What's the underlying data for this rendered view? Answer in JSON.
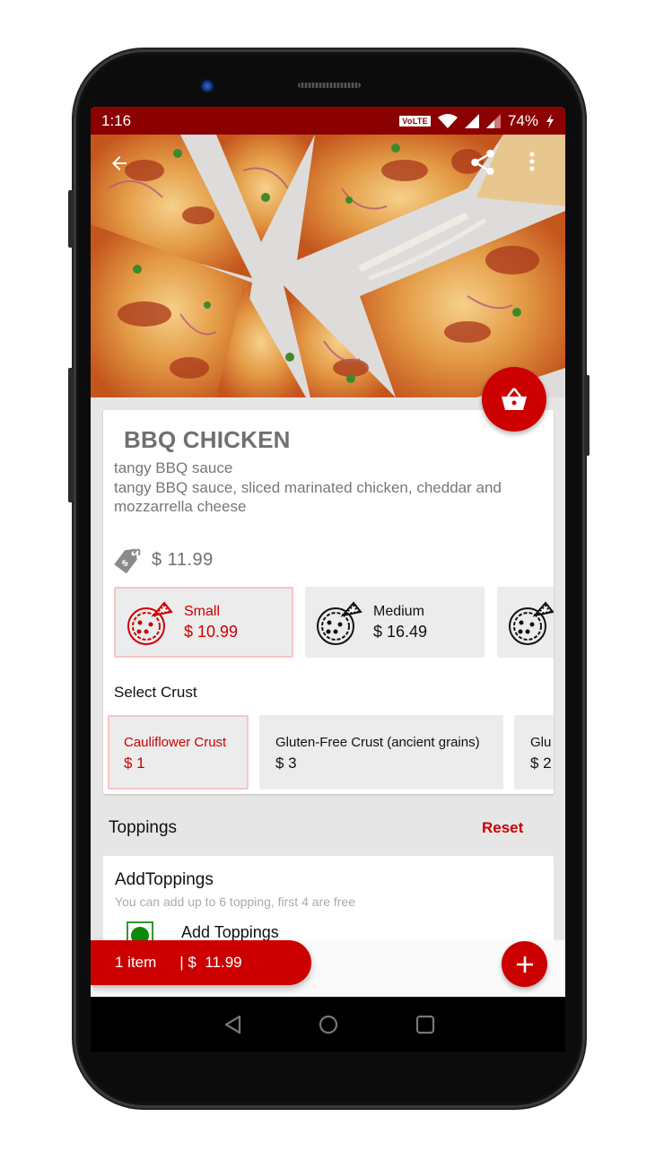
{
  "status_bar": {
    "time": "1:16",
    "volte_label": "VoLTE",
    "battery": "74%",
    "icons": [
      "wifi-icon",
      "signal-icon",
      "signal-weak-icon",
      "charging-icon"
    ]
  },
  "hero": {
    "back_icon": "arrow-left-icon",
    "share_icon": "share-icon",
    "more_icon": "more-vertical-icon",
    "cart_icon": "basket-icon"
  },
  "product": {
    "title": "BBQ CHICKEN",
    "subtitle": "tangy BBQ sauce",
    "description": "tangy BBQ sauce, sliced marinated chicken, cheddar and mozzarrella cheese",
    "price": "$ 11.99",
    "price_icon": "price-tag-icon"
  },
  "sizes": [
    {
      "label": "Small",
      "price": "$ 10.99",
      "selected": true
    },
    {
      "label": "Medium",
      "price": "$ 16.49",
      "selected": false
    },
    {
      "label": "",
      "price": "",
      "selected": false
    }
  ],
  "crust": {
    "heading": "Select Crust",
    "options": [
      {
        "label": "Cauliflower Crust",
        "price": "$ 1",
        "selected": true
      },
      {
        "label": "Gluten-Free Crust (ancient grains)",
        "price": "$ 3",
        "selected": false
      },
      {
        "label": "Glu",
        "price": "$ 2",
        "selected": false
      }
    ]
  },
  "toppings": {
    "heading": "Toppings",
    "reset_label": "Reset",
    "card_title": "AddToppings",
    "card_subtitle": "You can add up to 6 topping, first 4 are free",
    "item_label": "Add Toppings"
  },
  "cart_bar": {
    "items": "1 item",
    "total": "| $  11.99",
    "add_icon": "plus-icon"
  },
  "colors": {
    "accent": "#cc0000",
    "status_bar": "#8b0000",
    "check_green": "#0a8a0a"
  }
}
